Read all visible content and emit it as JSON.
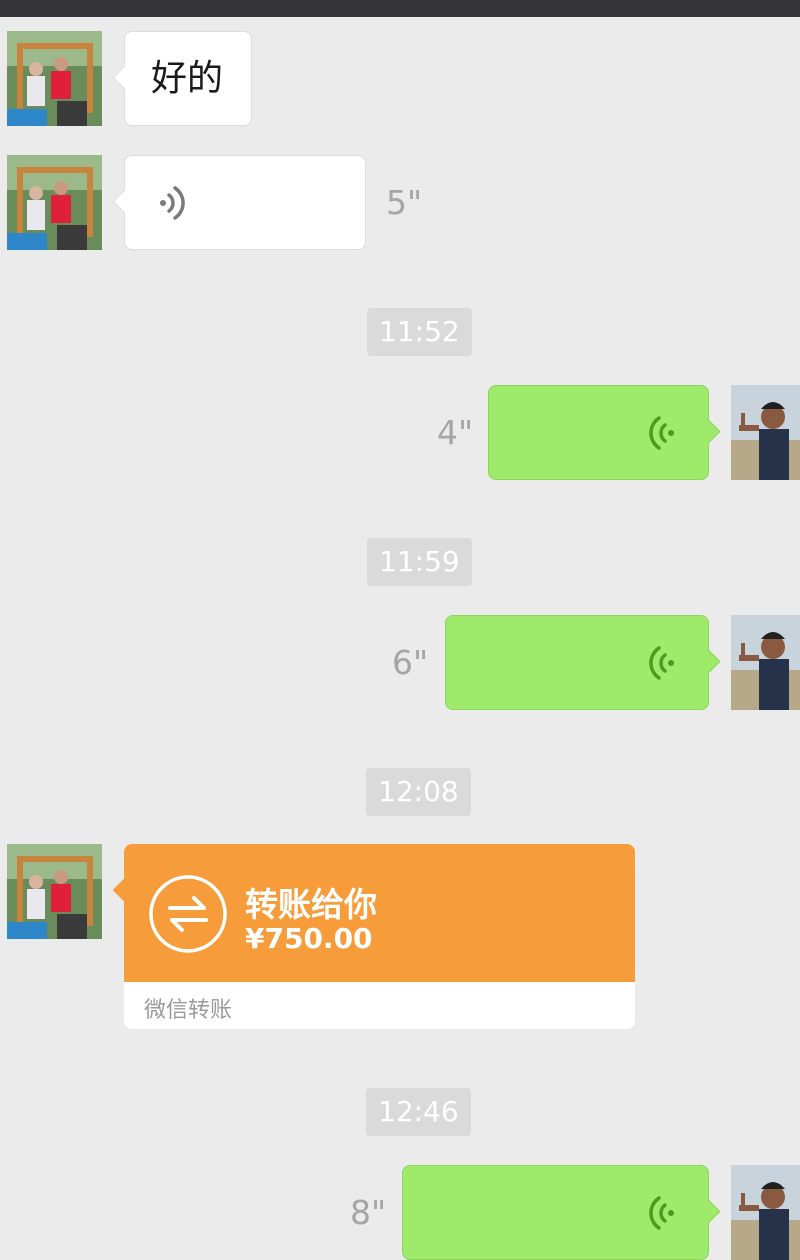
{
  "messages": [
    {
      "type": "text",
      "side": "left",
      "text": "好的"
    },
    {
      "type": "voice",
      "side": "left",
      "duration": "5\""
    },
    {
      "type": "time",
      "text": "11:52"
    },
    {
      "type": "voice",
      "side": "right",
      "duration": "4\""
    },
    {
      "type": "time",
      "text": "11:59"
    },
    {
      "type": "voice",
      "side": "right",
      "duration": "6\""
    },
    {
      "type": "time",
      "text": "12:08"
    },
    {
      "type": "transfer",
      "side": "left",
      "title": "转账给你",
      "amount": "¥750.00",
      "footer": "微信转账"
    },
    {
      "type": "time",
      "text": "12:46"
    },
    {
      "type": "voice",
      "side": "right",
      "duration": "8\""
    }
  ],
  "colors": {
    "background": "#ebebeb",
    "top_bar": "#343436",
    "self_bubble": "#9eea6a",
    "transfer": "#f79c3b",
    "voice_icon_right": "#4b9a22"
  },
  "icons": {
    "voice_left": "voice-wave-icon",
    "voice_right": "voice-wave-icon",
    "transfer": "transfer-arrows-icon"
  }
}
